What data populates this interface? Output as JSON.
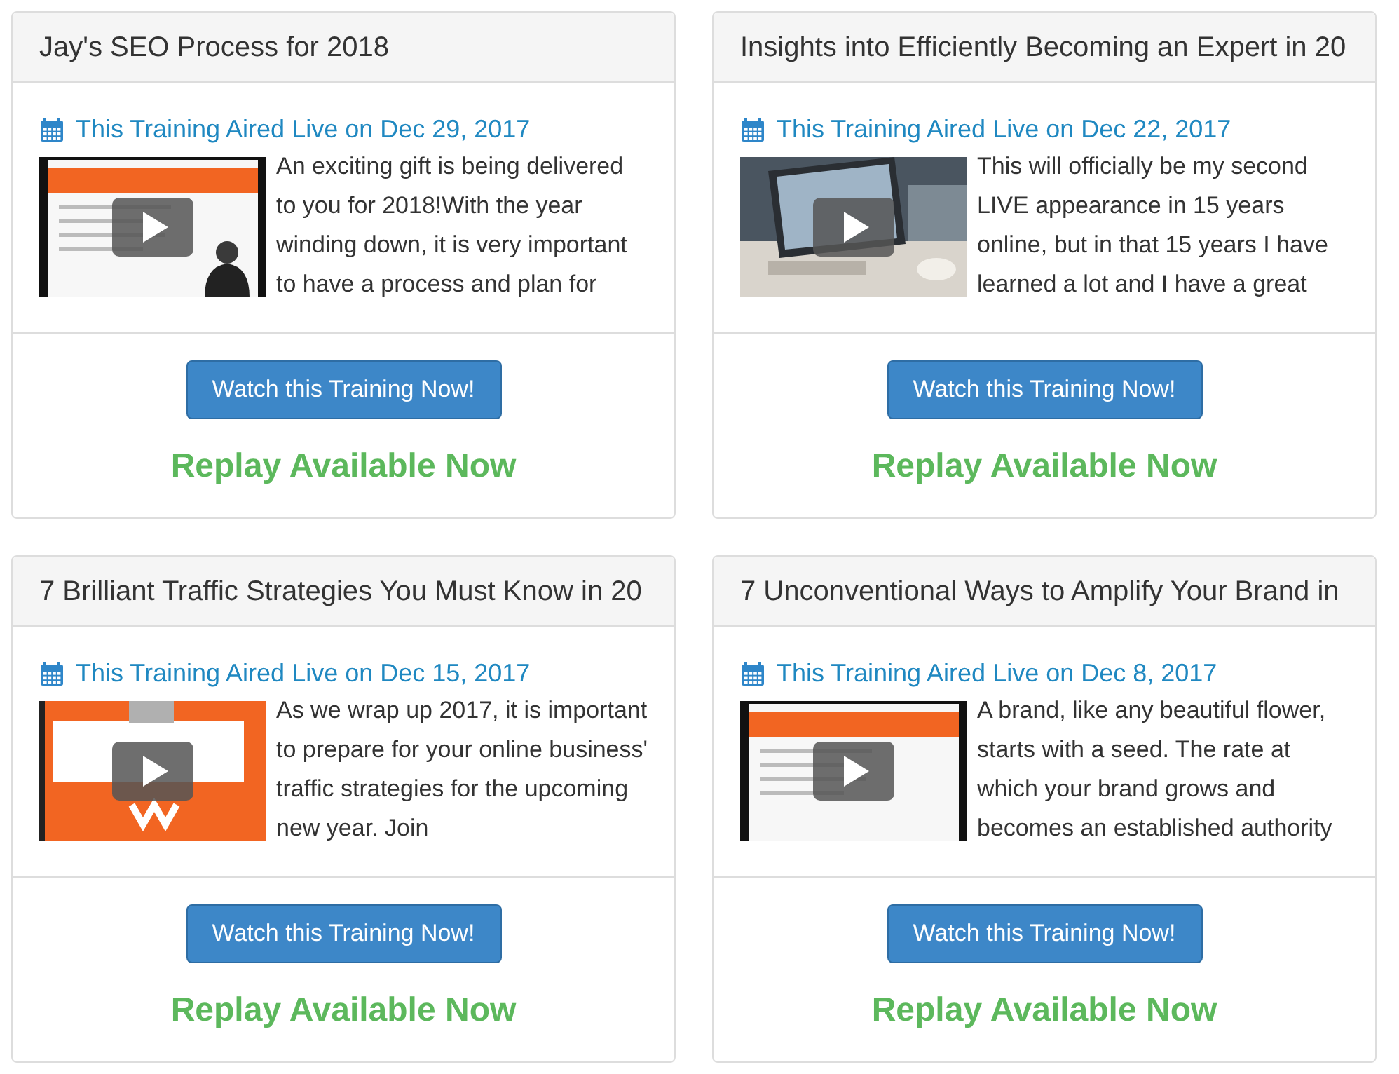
{
  "cards": [
    {
      "title": "Jay's SEO Process for 2018",
      "date": "This Training Aired Live on Dec 29, 2017",
      "description": "An exciting gift is being delivered to you for 2018!With the year winding down, it is very important to have a process and plan for",
      "button": "Watch this Training Now!",
      "status": "Replay Available Now"
    },
    {
      "title": "Insights into Efficiently Becoming an Expert in 20",
      "date": "This Training Aired Live on Dec 22, 2017",
      "description": "This will officially be my second LIVE appearance in 15 years online, but in that 15 years I have learned a lot and I have a great",
      "button": "Watch this Training Now!",
      "status": "Replay Available Now"
    },
    {
      "title": "7 Brilliant Traffic Strategies You Must Know in 20",
      "date": "This Training Aired Live on Dec 15, 2017",
      "description": "As we wrap up 2017, it is important to prepare for your online business' traffic strategies for the upcoming new year. Join",
      "button": "Watch this Training Now!",
      "status": "Replay Available Now"
    },
    {
      "title": "7 Unconventional Ways to Amplify Your Brand in",
      "date": "This Training Aired Live on Dec 8, 2017",
      "description": "A brand, like any beautiful flower, starts with a seed. The rate at which your brand grows and becomes an established authority",
      "button": "Watch this Training Now!",
      "status": "Replay Available Now"
    }
  ]
}
